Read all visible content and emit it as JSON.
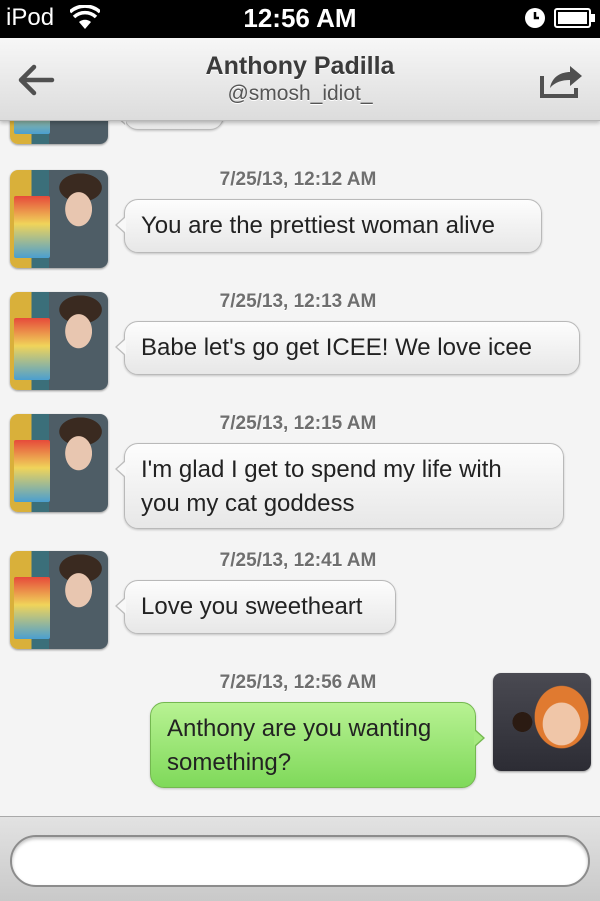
{
  "status_bar": {
    "carrier": "iPod",
    "time": "12:56 AM",
    "icons": [
      "wifi-icon",
      "clock-icon",
      "battery-icon"
    ]
  },
  "header": {
    "name": "Anthony Padilla",
    "handle": "@smosh_idiot_",
    "back_icon": "back-arrow-icon",
    "share_icon": "share-icon"
  },
  "messages": [
    {
      "timestamp": "7/25/13, 12:12 AM",
      "direction": "incoming",
      "lines": [
        "You are the prettiest woman alive"
      ]
    },
    {
      "timestamp": "7/25/13, 12:13 AM",
      "direction": "incoming",
      "lines": [
        "Babe let's go get ICEE! We love icee"
      ]
    },
    {
      "timestamp": "7/25/13, 12:15 AM",
      "direction": "incoming",
      "lines": [
        "I'm glad I get to spend my life with",
        "you my cat goddess"
      ]
    },
    {
      "timestamp": "7/25/13, 12:41 AM",
      "direction": "incoming",
      "lines": [
        "Love you sweetheart"
      ]
    },
    {
      "timestamp": "7/25/13, 12:56 AM",
      "direction": "outgoing",
      "lines": [
        "Anthony are you wanting",
        "something?"
      ]
    }
  ],
  "compose": {
    "value": "",
    "placeholder": ""
  },
  "colors": {
    "incoming_bubble": "#f0f0f0",
    "outgoing_bubble": "#8fe066",
    "status_bar": "#000000"
  }
}
